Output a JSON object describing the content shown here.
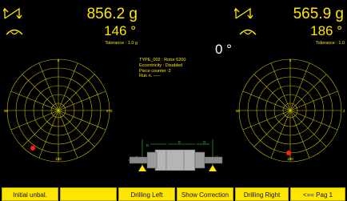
{
  "left": {
    "weight": "856.2 g",
    "angle": "146 °",
    "tolerance": "Tolerance : 1.0 g",
    "polar_labels": {
      "top": "0",
      "left": "90",
      "right": "270",
      "bottom": "180"
    }
  },
  "right": {
    "weight": "565.9 g",
    "angle": "186 °",
    "tolerance": "Tolerance : 1.0",
    "polar_labels": {
      "top": "0",
      "left": "90",
      "right": "2",
      "bottom": "180"
    }
  },
  "center": {
    "angle": "0 °",
    "info": {
      "type": "TYPE_002 : Rotor 6200",
      "eccentricity": "Eccentricity : Disabled",
      "piece_counter": "Piece counter :2",
      "run": "Run n. -----"
    },
    "dimension_labels": {
      "a": "D",
      "b": "D",
      "c": "D",
      "r1": "r1",
      "r2": "r2"
    }
  },
  "buttons": [
    {
      "label": "Initial unbal."
    },
    {
      "label": ""
    },
    {
      "label": "Drilling Left"
    },
    {
      "label": "Show Correction"
    },
    {
      "label": "Drilling Right"
    },
    {
      "label": "<== Pag 1"
    }
  ],
  "colors": {
    "accent": "#ffe600",
    "marker": "#ff1e1e",
    "background": "#000000"
  }
}
